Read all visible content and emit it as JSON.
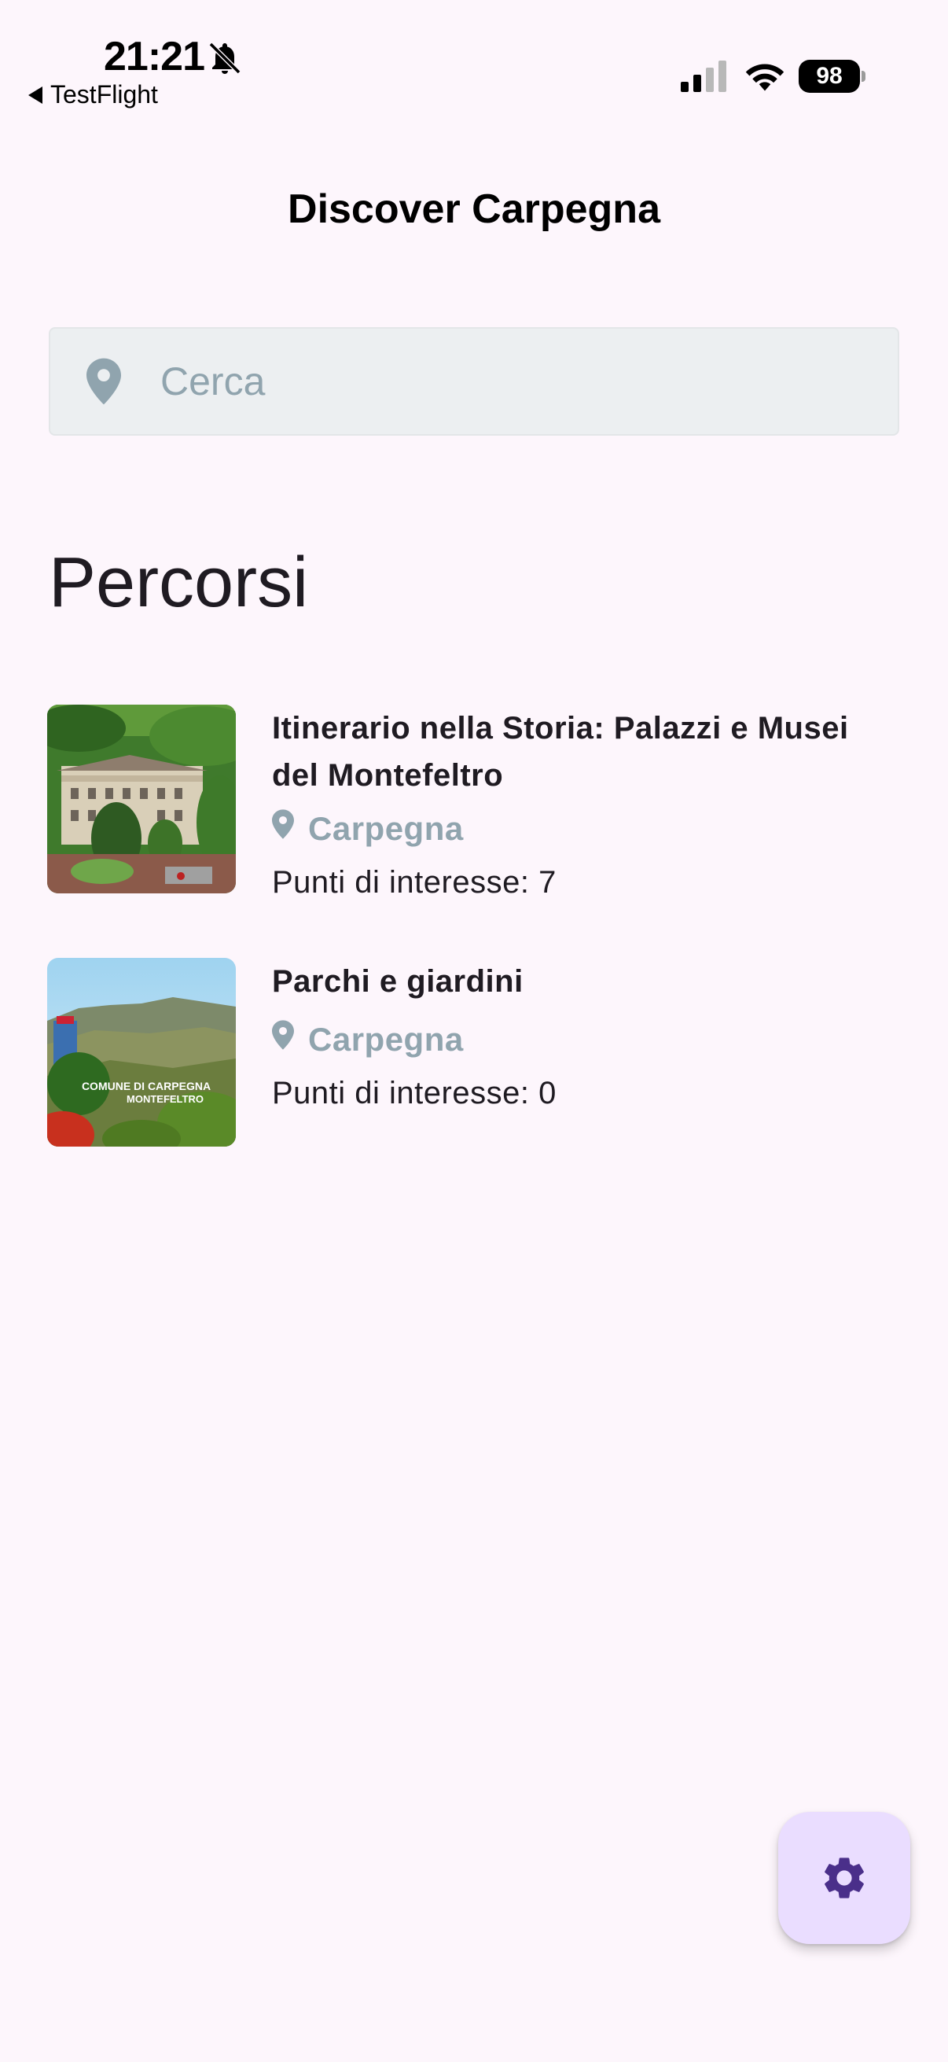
{
  "status_bar": {
    "time": "21:21",
    "back_app": "TestFlight",
    "battery": "98"
  },
  "app_bar": {
    "title": "Discover Carpegna"
  },
  "search": {
    "placeholder": "Cerca"
  },
  "section": {
    "title": "Percorsi"
  },
  "routes": [
    {
      "name": "Itinerario nella Storia: Palazzi e Musei del Montefeltro",
      "location": "Carpegna",
      "poi": "Punti di interesse: 7"
    },
    {
      "name": "Parchi e giardini",
      "location": "Carpegna",
      "poi": "Punti di interesse: 0",
      "image_caption": "COMUNE DI CARPEGNA MONTEFELTRO"
    }
  ],
  "colors": {
    "background": "#fdf6fc",
    "muted": "#90a4ae",
    "fab": "#eaddff",
    "fab_icon": "#4a2f8a"
  },
  "icons": {
    "bell": "bell-slash-icon",
    "location": "location-pin-icon",
    "settings": "gear-icon"
  }
}
